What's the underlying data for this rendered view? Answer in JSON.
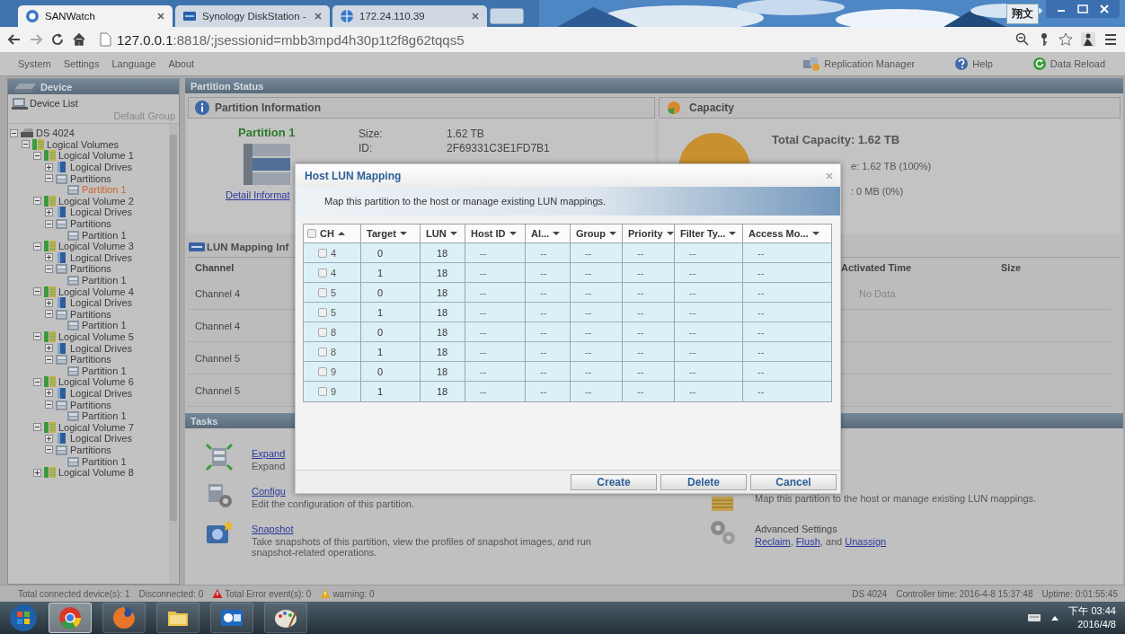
{
  "browser": {
    "tabs": [
      {
        "title": "SANWatch",
        "kind": "sanwatch",
        "selected": true
      },
      {
        "title": "Synology DiskStation -",
        "kind": "synology",
        "selected": false
      },
      {
        "title": "172.24.110.39",
        "kind": "globe",
        "selected": false
      }
    ],
    "ime": "翔文",
    "address": {
      "host": "127.0.0.1",
      "rest": ":8818/;jsessionid=mbb3mpd4h30p1t2f8g62tqqs5"
    }
  },
  "menu": {
    "items": [
      "System",
      "Settings",
      "Language",
      "About"
    ],
    "actions": [
      {
        "label": "Replication Manager",
        "kind": "replication"
      },
      {
        "label": "Help",
        "kind": "help"
      },
      {
        "label": "Data Reload",
        "kind": "reload"
      }
    ]
  },
  "sidebar": {
    "title": "Device",
    "list_title": "Device List",
    "group": "Default Group",
    "tree": [
      {
        "label": "DS 4024",
        "kind": "device",
        "expanded": true,
        "selected": false,
        "children": [
          {
            "label": "Logical Volumes",
            "kind": "volumes",
            "expanded": true,
            "selected": false,
            "children": [
              {
                "label": "Logical Volume 1",
                "kind": "volume",
                "expanded": true,
                "selected": false,
                "children": [
                  {
                    "label": "Logical Drives",
                    "kind": "drives",
                    "expanded": false,
                    "selected": false
                  },
                  {
                    "label": "Partitions",
                    "kind": "partitions",
                    "expanded": true,
                    "selected": false,
                    "children": [
                      {
                        "label": "Partition 1",
                        "kind": "partition",
                        "selected": true
                      }
                    ]
                  }
                ]
              },
              {
                "label": "Logical Volume 2",
                "kind": "volume",
                "expanded": true,
                "selected": false,
                "children": [
                  {
                    "label": "Logical Drives",
                    "kind": "drives",
                    "expanded": false,
                    "selected": false
                  },
                  {
                    "label": "Partitions",
                    "kind": "partitions",
                    "expanded": true,
                    "selected": false,
                    "children": [
                      {
                        "label": "Partition 1",
                        "kind": "partition",
                        "selected": false
                      }
                    ]
                  }
                ]
              },
              {
                "label": "Logical Volume 3",
                "kind": "volume",
                "expanded": true,
                "selected": false,
                "children": [
                  {
                    "label": "Logical Drives",
                    "kind": "drives",
                    "expanded": false,
                    "selected": false
                  },
                  {
                    "label": "Partitions",
                    "kind": "partitions",
                    "expanded": true,
                    "selected": false,
                    "children": [
                      {
                        "label": "Partition 1",
                        "kind": "partition",
                        "selected": false
                      }
                    ]
                  }
                ]
              },
              {
                "label": "Logical Volume 4",
                "kind": "volume",
                "expanded": true,
                "selected": false,
                "children": [
                  {
                    "label": "Logical Drives",
                    "kind": "drives",
                    "expanded": false,
                    "selected": false
                  },
                  {
                    "label": "Partitions",
                    "kind": "partitions",
                    "expanded": true,
                    "selected": false,
                    "children": [
                      {
                        "label": "Partition 1",
                        "kind": "partition",
                        "selected": false
                      }
                    ]
                  }
                ]
              },
              {
                "label": "Logical Volume 5",
                "kind": "volume",
                "expanded": true,
                "selected": false,
                "children": [
                  {
                    "label": "Logical Drives",
                    "kind": "drives",
                    "expanded": false,
                    "selected": false
                  },
                  {
                    "label": "Partitions",
                    "kind": "partitions",
                    "expanded": true,
                    "selected": false,
                    "children": [
                      {
                        "label": "Partition 1",
                        "kind": "partition",
                        "selected": false
                      }
                    ]
                  }
                ]
              },
              {
                "label": "Logical Volume 6",
                "kind": "volume",
                "expanded": true,
                "selected": false,
                "children": [
                  {
                    "label": "Logical Drives",
                    "kind": "drives",
                    "expanded": false,
                    "selected": false
                  },
                  {
                    "label": "Partitions",
                    "kind": "partitions",
                    "expanded": true,
                    "selected": false,
                    "children": [
                      {
                        "label": "Partition 1",
                        "kind": "partition",
                        "selected": false
                      }
                    ]
                  }
                ]
              },
              {
                "label": "Logical Volume 7",
                "kind": "volume",
                "expanded": true,
                "selected": false,
                "children": [
                  {
                    "label": "Logical Drives",
                    "kind": "drives",
                    "expanded": false,
                    "selected": false
                  },
                  {
                    "label": "Partitions",
                    "kind": "partitions",
                    "expanded": true,
                    "selected": false,
                    "children": [
                      {
                        "label": "Partition 1",
                        "kind": "partition",
                        "selected": false
                      }
                    ]
                  }
                ]
              },
              {
                "label": "Logical Volume 8",
                "kind": "volume",
                "expanded": false,
                "selected": false
              }
            ]
          }
        ]
      }
    ]
  },
  "main": {
    "title": "Partition Status",
    "info": {
      "title": "Partition Information",
      "name": "Partition 1",
      "fields": [
        {
          "label": "Size:",
          "value": "1.62 TB"
        },
        {
          "label": "ID:",
          "value": "2F69331C3E1FD7B1"
        }
      ],
      "detail_link": "Detail Informat"
    },
    "capacity": {
      "title": "Capacity",
      "total": "Total Capacity: 1.62 TB",
      "lines": [
        "e: 1.62 TB (100%)",
        ": 0 MB (0%)"
      ]
    },
    "lun_info": {
      "title": "LUN Mapping Inf",
      "columns": [
        "Channel",
        "Activated Time",
        "Size"
      ],
      "rows": [
        "Channel 4",
        "Channel 4",
        "Channel 5",
        "Channel 5"
      ],
      "empty": "No Data"
    },
    "tasks": {
      "title": "Tasks",
      "left": [
        {
          "kind": "expand",
          "link": "Expand",
          "desc": "Expand"
        },
        {
          "kind": "configure",
          "link": "Configu",
          "desc": "Edit the configuration of this partition."
        },
        {
          "kind": "snapshot",
          "link": "Snapshot",
          "desc": "Take snapshots of this partition, view the profiles of snapshot images, and run snapshot-related operations."
        }
      ],
      "right": [
        {
          "kind": "lun",
          "desc": "Map this partition to the host or manage existing LUN mappings."
        },
        {
          "kind": "advanced",
          "title": "Advanced Settings",
          "parts": [
            {
              "text": "Reclaim",
              "link": true
            },
            {
              "text": ", ",
              "link": false
            },
            {
              "text": "Flush",
              "link": true
            },
            {
              "text": ", and ",
              "link": false
            },
            {
              "text": "Unassign",
              "link": true
            }
          ]
        }
      ]
    }
  },
  "dialog": {
    "title": "Host LUN Mapping",
    "intro": "Map this partition to the host or manage existing LUN mappings.",
    "all_checked": false,
    "columns": [
      {
        "label": "CH",
        "sorted": true
      },
      {
        "label": "Target",
        "sorted": false
      },
      {
        "label": "LUN",
        "sorted": false
      },
      {
        "label": "Host ID",
        "sorted": false
      },
      {
        "label": "Al...",
        "sorted": false
      },
      {
        "label": "Group",
        "sorted": false
      },
      {
        "label": "Priority",
        "sorted": false
      },
      {
        "label": "Filter Ty...",
        "sorted": false
      },
      {
        "label": "Access Mo...",
        "sorted": false
      }
    ],
    "rows": [
      {
        "checked": false,
        "cells": [
          "4",
          "0",
          "18",
          "--",
          "--",
          "--",
          "--",
          "--",
          "--"
        ]
      },
      {
        "checked": false,
        "cells": [
          "4",
          "1",
          "18",
          "--",
          "--",
          "--",
          "--",
          "--",
          "--"
        ]
      },
      {
        "checked": false,
        "cells": [
          "5",
          "0",
          "18",
          "--",
          "--",
          "--",
          "--",
          "--",
          "--"
        ]
      },
      {
        "checked": false,
        "cells": [
          "5",
          "1",
          "18",
          "--",
          "--",
          "--",
          "--",
          "--",
          "--"
        ]
      },
      {
        "checked": false,
        "cells": [
          "8",
          "0",
          "18",
          "--",
          "--",
          "--",
          "--",
          "--",
          "--"
        ]
      },
      {
        "checked": false,
        "cells": [
          "8",
          "1",
          "18",
          "--",
          "--",
          "--",
          "--",
          "--",
          "--"
        ]
      },
      {
        "checked": false,
        "cells": [
          "9",
          "0",
          "18",
          "--",
          "--",
          "--",
          "--",
          "--",
          "--"
        ]
      },
      {
        "checked": false,
        "cells": [
          "9",
          "1",
          "18",
          "--",
          "--",
          "--",
          "--",
          "--",
          "--"
        ]
      }
    ],
    "buttons": [
      "Create",
      "Delete",
      "Cancel"
    ]
  },
  "status_bar": {
    "left": [
      {
        "kind": "plain",
        "text": "Total connected device(s): 1"
      },
      {
        "kind": "plain",
        "text": "Disconnected: 0"
      },
      {
        "kind": "error",
        "text": "Total Error event(s): 0"
      },
      {
        "kind": "warning",
        "text": "warning: 0"
      }
    ],
    "right": [
      "DS 4024",
      "Controller time: 2016-4-8 15:37:48",
      "Uptime: 0:01:55:45"
    ]
  },
  "taskbar": {
    "apps": [
      {
        "kind": "chrome",
        "selected": true
      },
      {
        "kind": "firefox",
        "selected": false
      },
      {
        "kind": "folder",
        "selected": false
      },
      {
        "kind": "mail",
        "selected": false
      },
      {
        "kind": "paint",
        "selected": false
      }
    ],
    "time": "下午 03:44",
    "date": "2016/4/8"
  }
}
